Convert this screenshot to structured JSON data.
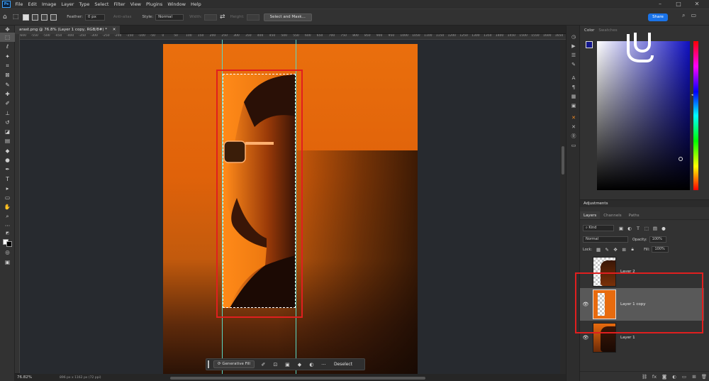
{
  "app": {
    "logo_text": "Ps"
  },
  "menu": [
    "File",
    "Edit",
    "Image",
    "Layer",
    "Type",
    "Select",
    "Filter",
    "View",
    "Plugins",
    "Window",
    "Help"
  ],
  "window_controls": {
    "minimize": "–",
    "maximize": "□",
    "close": "✕"
  },
  "options": {
    "feather_label": "Feather:",
    "feather_value": "0 px",
    "anti_alias_label": "Anti-alias",
    "style_label": "Style:",
    "style_value": "Normal",
    "width_label": "Width:",
    "height_label": "Height:",
    "select_mask_button": "Select and Mask...",
    "share_button": "Share"
  },
  "document": {
    "tab_title": "arast.png @ 76.8% (Layer 1 copy, RGB/8#) *",
    "zoom": "76.82%",
    "size": "896 px x 1162 px (72 ppi)"
  },
  "ruler": {
    "ticks": [
      "-650",
      "-600",
      "-550",
      "-500",
      "-450",
      "-400",
      "-350",
      "-300",
      "-250",
      "-200",
      "-150",
      "-100",
      "-50",
      "0",
      "50",
      "100",
      "150",
      "200",
      "250",
      "300",
      "350",
      "400",
      "450",
      "500",
      "550",
      "600",
      "650",
      "700",
      "750",
      "800",
      "850",
      "900",
      "950",
      "1000",
      "1050",
      "1100",
      "1150",
      "1200",
      "1250",
      "1300",
      "1350",
      "1400",
      "1450",
      "1500",
      "1550",
      "1600",
      "1650"
    ]
  },
  "context_bar": {
    "generative_fill": "Generative Fill",
    "deselect": "Deselect"
  },
  "color_panel": {
    "tabs": [
      "Color",
      "Swatches"
    ],
    "foreground": "#14188c",
    "background": "#ffffff",
    "hue_color": "#1010c0"
  },
  "adjustments": {
    "title": "Adjustments"
  },
  "layers_panel": {
    "tabs": [
      "Layers",
      "Channels",
      "Paths"
    ],
    "kind": "Kind",
    "blend_mode": "Normal",
    "opacity_label": "Opacity:",
    "opacity": "100%",
    "lock_label": "Lock:",
    "fill_label": "Fill:",
    "fill": "100%",
    "layers": [
      {
        "name": "Layer 2",
        "visible": false
      },
      {
        "name": "Layer 1 copy",
        "visible": true,
        "selected": true
      },
      {
        "name": "Layer 1",
        "visible": true
      }
    ]
  },
  "colors": {
    "accent": "#1a73e8",
    "highlight_box": "#e01f1f",
    "guide": "#5ad8c5"
  }
}
